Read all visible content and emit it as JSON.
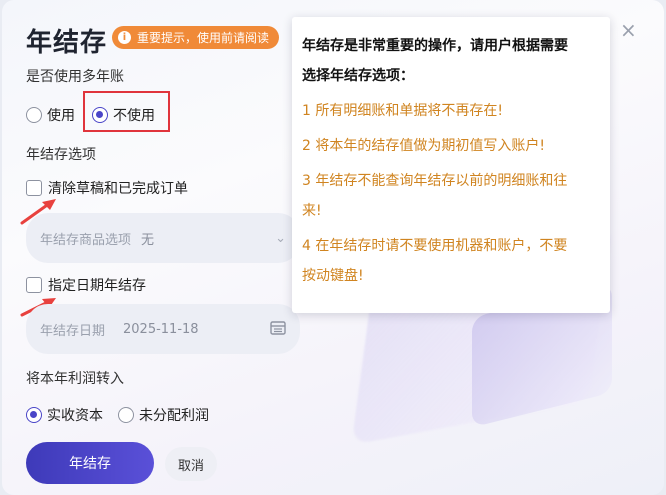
{
  "dialog": {
    "title": "年结存",
    "notice": "重要提示，使用前请阅读",
    "close_glyph": "×"
  },
  "multi_year": {
    "label": "是否使用多年账",
    "options": [
      "使用",
      "不使用"
    ],
    "selected": "不使用"
  },
  "options_section": {
    "label": "年结存选项",
    "clear_orders_label": "清除草稿和已完成订单",
    "product_field_label": "年结存商品选项",
    "product_field_value": "无",
    "date_check_label": "指定日期年结存",
    "date_field_label": "年结存日期",
    "date_field_value": "2025-11-18"
  },
  "profit": {
    "label": "将本年利润转入",
    "options": [
      "实收资本",
      "未分配利润"
    ],
    "selected": "实收资本"
  },
  "buttons": {
    "confirm": "年结存",
    "cancel": "取消"
  },
  "tooltip": {
    "head_line1": "年结存是非常重要的操作，请用户根据需要",
    "head_line2": "选择年结存选项：",
    "item1": "1 所有明细账和单据将不再存在!",
    "item2": "2 将本年的结存值做为期初值写入账户!",
    "item3_line1": "3 年结存不能查询年结存以前的明细账和往",
    "item3_line2": "来!",
    "item4_line1": "4 在年结存时请不要使用机器和账户，不要",
    "item4_line2": "按动键盘!"
  },
  "colors": {
    "accent": "#4a45c8",
    "notice": "#f08a38",
    "annotation": "#e0343c",
    "tip_text": "#d08420"
  }
}
